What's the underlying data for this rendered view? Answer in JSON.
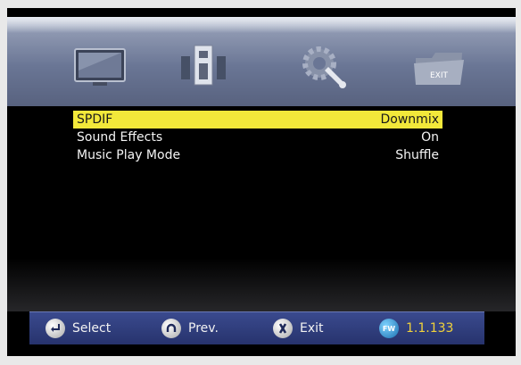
{
  "icon_bar": {
    "items": [
      {
        "icon": "tv-icon"
      },
      {
        "icon": "speaker-icon"
      },
      {
        "icon": "gear-wrench-icon"
      },
      {
        "icon": "exit-folder-icon",
        "label": "EXIT"
      }
    ]
  },
  "menu": {
    "items": [
      {
        "label": "SPDIF",
        "value": "Downmix",
        "selected": true
      },
      {
        "label": "Sound Effects",
        "value": "On"
      },
      {
        "label": "Music Play Mode",
        "value": "Shuffle"
      }
    ]
  },
  "footer": {
    "select_label": "Select",
    "prev_label": "Prev.",
    "exit_label": "Exit",
    "fw_badge": "FW",
    "fw_version": "1.1.133"
  },
  "colors": {
    "highlight": "#f2e83a",
    "footer_bg": "#2c3877",
    "fw_version": "#f1d23a"
  }
}
